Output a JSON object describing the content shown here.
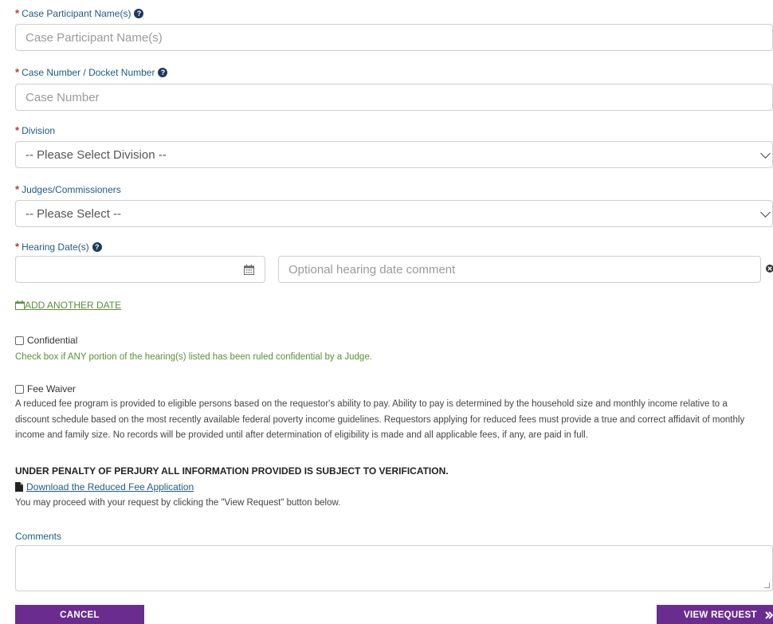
{
  "fields": {
    "participant": {
      "label": "Case Participant Name(s)",
      "placeholder": "Case Participant Name(s)"
    },
    "case_number": {
      "label": "Case Number / Docket Number",
      "placeholder": "Case Number"
    },
    "division": {
      "label": "Division",
      "selected": "-- Please Select Division --"
    },
    "judges": {
      "label": "Judges/Commissioners",
      "selected": "-- Please Select --"
    },
    "hearing": {
      "label": "Hearing Date(s)",
      "comment_placeholder": "Optional hearing date comment"
    }
  },
  "required_mark": "*",
  "help_glyph": "?",
  "add_date_label": "ADD ANOTHER DATE",
  "confidential": {
    "label": "Confidential",
    "note": "Check box if ANY portion of the hearing(s) listed has been ruled confidential by a Judge."
  },
  "fee_waiver": {
    "label": "Fee Waiver",
    "description": "A reduced fee program is provided to eligible persons based on the requestor's ability to pay. Ability to pay is determined by the household size and monthly income relative to a discount schedule based on the most recently available federal poverty income guidelines. Requestors applying for reduced fees must provide a true and correct affidavit of monthly income and family size. No records will be provided until after determination of eligibility is made and all applicable fees, if any, are paid in full.",
    "warning": "UNDER PENALTY OF PERJURY ALL INFORMATION PROVIDED IS SUBJECT TO VERIFICATION.",
    "download_link": "Download the Reduced Fee Application",
    "proceed_note": "You may proceed with your request by clicking the \"View Request\" button below."
  },
  "comments_label": "Comments",
  "buttons": {
    "cancel": "CANCEL",
    "view_request": "VIEW REQUEST"
  },
  "colors": {
    "label_blue": "#1f5a8a",
    "required_red": "#c0392b",
    "note_green": "#5a8f3a",
    "button_purple": "#6b2c8f"
  },
  "icons": [
    "help-icon",
    "calendar-icon",
    "remove-icon",
    "calendar-add-icon",
    "file-icon",
    "arrow-right-icon",
    "chevron-down-icon"
  ]
}
